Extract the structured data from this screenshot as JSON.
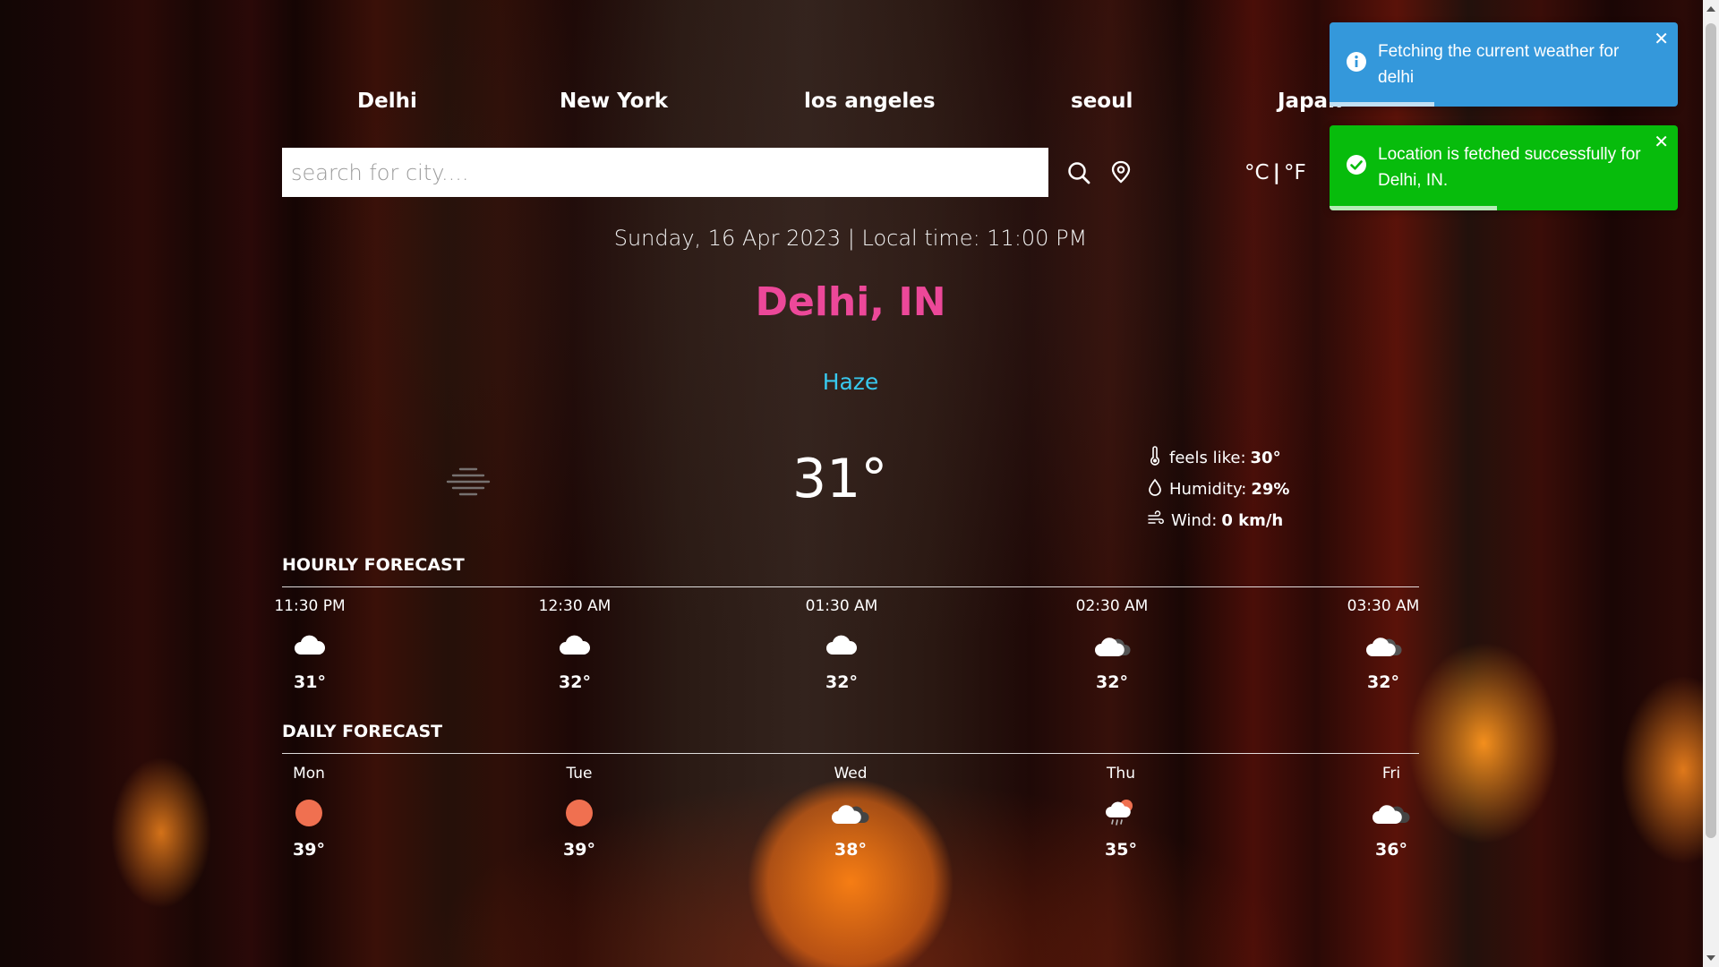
{
  "nav": {
    "cities": [
      "Delhi",
      "New York",
      "los angeles",
      "seoul",
      "Japan"
    ]
  },
  "search": {
    "placeholder": "search for city....",
    "value": ""
  },
  "units": {
    "celsius": "°C",
    "separator": "|",
    "fahrenheit": "°F"
  },
  "header": {
    "date_line": "Sunday, 16 Apr 2023 | Local time: 11:00 PM",
    "city": "Delhi, IN",
    "condition": "Haze"
  },
  "current": {
    "icon": "haze-icon",
    "temp": "31°",
    "feels_like_label": "feels like:",
    "feels_like": "30°",
    "humidity_label": "Humidity:",
    "humidity": "29%",
    "wind_label": "Wind:",
    "wind": "0 km/h"
  },
  "hourly": {
    "title": "HOURLY FORECAST",
    "items": [
      {
        "time": "11:30 PM",
        "icon": "cloud-icon",
        "temp": "31°"
      },
      {
        "time": "12:30 AM",
        "icon": "cloud-icon",
        "temp": "32°"
      },
      {
        "time": "01:30 AM",
        "icon": "cloud-icon",
        "temp": "32°"
      },
      {
        "time": "02:30 AM",
        "icon": "broken-clouds-night-icon",
        "temp": "32°"
      },
      {
        "time": "03:30 AM",
        "icon": "broken-clouds-night-icon",
        "temp": "32°"
      }
    ]
  },
  "daily": {
    "title": "DAILY FORECAST",
    "items": [
      {
        "day": "Mon",
        "icon": "sun-icon",
        "temp": "39°"
      },
      {
        "day": "Tue",
        "icon": "sun-icon",
        "temp": "39°"
      },
      {
        "day": "Wed",
        "icon": "broken-clouds-icon",
        "temp": "38°"
      },
      {
        "day": "Thu",
        "icon": "rain-sun-icon",
        "temp": "35°"
      },
      {
        "day": "Fri",
        "icon": "broken-clouds-icon",
        "temp": "36°"
      }
    ]
  },
  "toasts": [
    {
      "type": "info",
      "text": "Fetching the current weather for delhi",
      "close": "✕",
      "progress": 0.3,
      "color": "#3498db"
    },
    {
      "type": "success",
      "text": "Location is fetched successfully for Delhi, IN.",
      "close": "✕",
      "progress": 0.48,
      "color": "#07bc0c"
    }
  ],
  "colors": {
    "city_title": "#ec4899",
    "condition": "#38c9ef",
    "sun": "#f07050"
  }
}
